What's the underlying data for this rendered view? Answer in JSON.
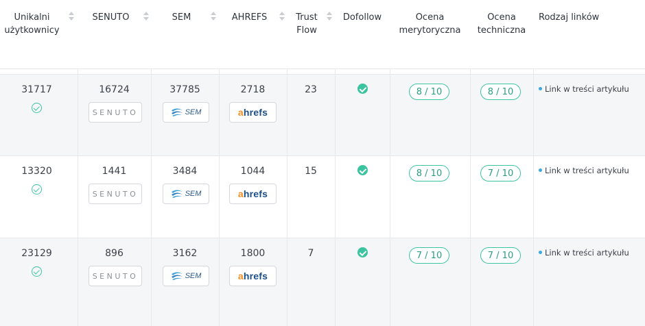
{
  "header": {
    "columns": [
      {
        "key": "users",
        "label_line1": "Unikalni",
        "label_line2": "użytkownicy",
        "sortable": true
      },
      {
        "key": "senuto",
        "label_line1": "SENUTO",
        "label_line2": "",
        "sortable": true
      },
      {
        "key": "sem",
        "label_line1": "SEM",
        "label_line2": "",
        "sortable": true
      },
      {
        "key": "ahrefs",
        "label_line1": "AHREFS",
        "label_line2": "",
        "sortable": true
      },
      {
        "key": "trust",
        "label_line1": "Trust",
        "label_line2": "Flow",
        "sortable": true
      },
      {
        "key": "dofollow",
        "label_line1": "Dofollow",
        "label_line2": "",
        "sortable": false
      },
      {
        "key": "merit",
        "label_line1": "Ocena",
        "label_line2": "merytoryczna",
        "sortable": false
      },
      {
        "key": "tech",
        "label_line1": "Ocena",
        "label_line2": "techniczna",
        "sortable": false
      },
      {
        "key": "linktype",
        "label_line1": "Rodzaj linków",
        "label_line2": "",
        "sortable": false
      }
    ]
  },
  "logos": {
    "senuto": "SENUTO",
    "sem": "SEM",
    "ahrefs_a": "a",
    "ahrefs_rest": "hrefs"
  },
  "rows": [
    {
      "users": "31717",
      "users_verified": true,
      "senuto": "16724",
      "sem": "37785",
      "ahrefs": "2718",
      "trust": "23",
      "dofollow": true,
      "merit": "8 / 10",
      "tech": "8 / 10",
      "linktype": "Link w treści artykułu"
    },
    {
      "users": "13320",
      "users_verified": true,
      "senuto": "1441",
      "sem": "3484",
      "ahrefs": "1044",
      "trust": "15",
      "dofollow": true,
      "merit": "8 / 10",
      "tech": "7 / 10",
      "linktype": "Link w treści artykułu"
    },
    {
      "users": "23129",
      "users_verified": true,
      "senuto": "896",
      "sem": "3162",
      "ahrefs": "1800",
      "trust": "7",
      "dofollow": true,
      "merit": "7 / 10",
      "tech": "7 / 10",
      "linktype": "Link w treści artykułu"
    }
  ],
  "colors": {
    "accent": "#3cc3a0",
    "row_alt": "#f5f6f8",
    "link_dot": "#3ba9e0",
    "ahrefs_blue": "#1b4f8a",
    "ahrefs_orange": "#f58d1e"
  }
}
